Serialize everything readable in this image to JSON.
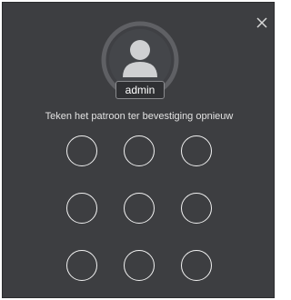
{
  "dialog": {
    "username": "admin",
    "instruction": "Teken het patroon ter bevestiging opnieuw",
    "close_icon": "close-icon",
    "avatar_icon": "user-avatar-icon",
    "pattern_dots": 9
  },
  "colors": {
    "background": "#3d3e41",
    "avatar_ring": "#5f6064",
    "avatar_fill": "#cfd0d2",
    "dot_border": "#f2f2f2"
  }
}
